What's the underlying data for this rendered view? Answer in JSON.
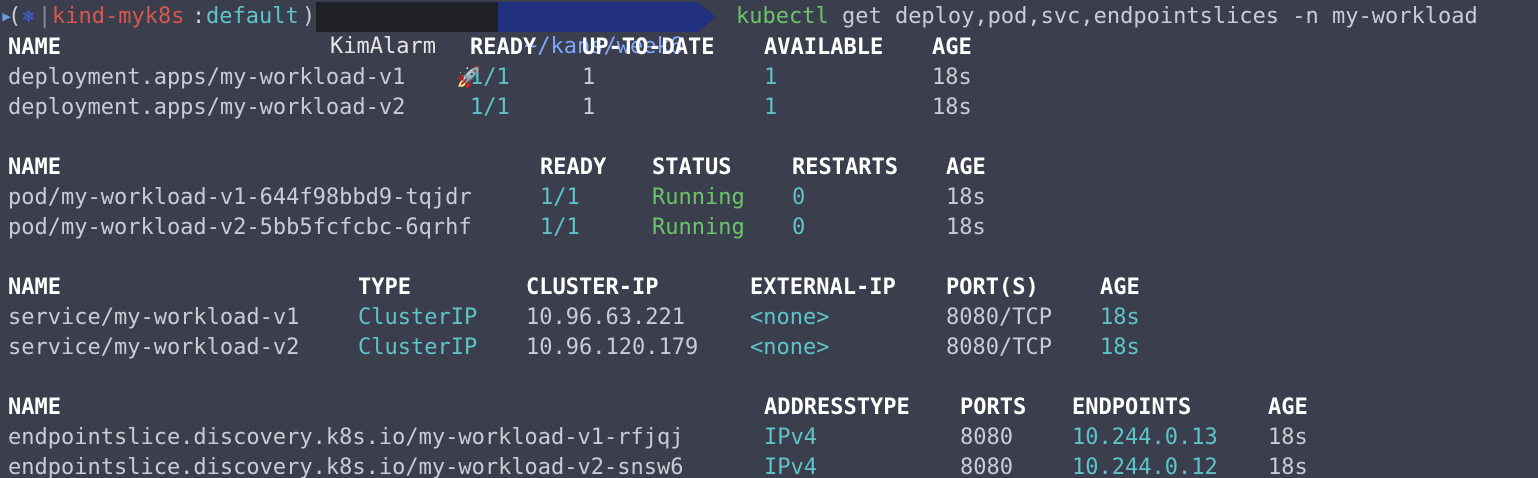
{
  "prompt": {
    "open_paren": "(",
    "k8s_symbol": "⎈",
    "separator": "|",
    "context": "kind-myk8s",
    "colon": ":",
    "namespace": "default",
    "close_paren": ")",
    "user": "KimAlarm",
    "rocket": "🚀",
    "path": "~/kans/week6",
    "command_name": "kubectl",
    "command_args": " get deploy,pod,svc,endpointslices -n my-workload"
  },
  "deployments": {
    "headers": [
      "NAME",
      "READY",
      "UP-TO-DATE",
      "AVAILABLE",
      "AGE"
    ],
    "rows": [
      [
        "deployment.apps/my-workload-v1",
        "1/1",
        "1",
        "1",
        "18s"
      ],
      [
        "deployment.apps/my-workload-v2",
        "1/1",
        "1",
        "1",
        "18s"
      ]
    ]
  },
  "pods": {
    "headers": [
      "NAME",
      "READY",
      "STATUS",
      "RESTARTS",
      "AGE"
    ],
    "rows": [
      [
        "pod/my-workload-v1-644f98bbd9-tqjdr",
        "1/1",
        "Running",
        "0",
        "18s"
      ],
      [
        "pod/my-workload-v2-5bb5fcfcbc-6qrhf",
        "1/1",
        "Running",
        "0",
        "18s"
      ]
    ]
  },
  "services": {
    "headers": [
      "NAME",
      "TYPE",
      "CLUSTER-IP",
      "EXTERNAL-IP",
      "PORT(S)",
      "AGE"
    ],
    "rows": [
      [
        "service/my-workload-v1",
        "ClusterIP",
        "10.96.63.221",
        "<none>",
        "8080/TCP",
        "18s"
      ],
      [
        "service/my-workload-v2",
        "ClusterIP",
        "10.96.120.179",
        "<none>",
        "8080/TCP",
        "18s"
      ]
    ]
  },
  "endpointslices": {
    "headers": [
      "NAME",
      "ADDRESSTYPE",
      "PORTS",
      "ENDPOINTS",
      "AGE"
    ],
    "rows": [
      [
        "endpointslice.discovery.k8s.io/my-workload-v1-rfjqj",
        "IPv4",
        "8080",
        "10.244.0.13",
        "18s"
      ],
      [
        "endpointslice.discovery.k8s.io/my-workload-v2-snsw6",
        "IPv4",
        "8080",
        "10.244.0.12",
        "18s"
      ]
    ]
  },
  "colors": {
    "background": "#3b3e4c",
    "text": "#c9ccd4",
    "cyan": "#5ec4c9",
    "green": "#6bc46b",
    "context_red": "#d6584e",
    "path_bg": "#21317f"
  }
}
